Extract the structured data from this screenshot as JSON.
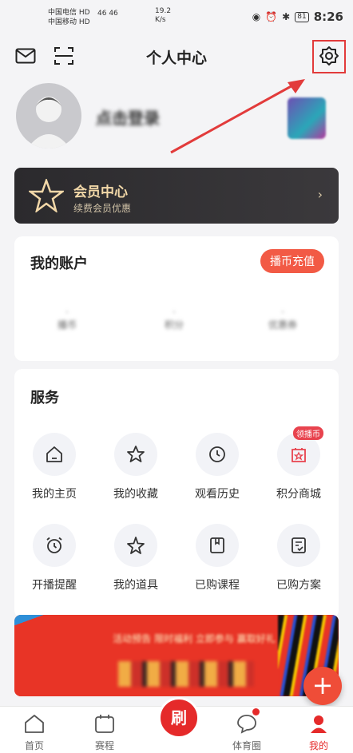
{
  "statusbar": {
    "carrier1": "中国电信",
    "carrier2": "中国移动",
    "hd": "HD",
    "signal": "46 46",
    "speed": "19.2",
    "speed_unit": "K/s",
    "battery": "81",
    "time": "8:26"
  },
  "header": {
    "title": "个人中心"
  },
  "profile": {
    "username": "点击登录"
  },
  "vip": {
    "title": "会员中心",
    "subtitle": "续费会员优惠"
  },
  "account": {
    "title": "我的账户",
    "recharge": "播币充值",
    "stats": [
      "播币",
      "积分",
      "优惠券"
    ]
  },
  "services": {
    "title": "服务",
    "items": [
      {
        "label": "我的主页"
      },
      {
        "label": "我的收藏"
      },
      {
        "label": "观看历史"
      },
      {
        "label": "积分商城",
        "tag": "领播币"
      },
      {
        "label": "开播提醒"
      },
      {
        "label": "我的道具"
      },
      {
        "label": "已购课程"
      },
      {
        "label": "已购方案"
      }
    ]
  },
  "banner": {
    "text": "活动预告 限时福利 立即参与 赢取好礼"
  },
  "tabs": [
    {
      "label": "首页"
    },
    {
      "label": "赛程"
    },
    {
      "label": "刷"
    },
    {
      "label": "体育圈"
    },
    {
      "label": "我的"
    }
  ],
  "colors": {
    "accent": "#e52a2a",
    "vip_gold": "#f2d8a8",
    "highlight_box": "#e23b3b"
  }
}
